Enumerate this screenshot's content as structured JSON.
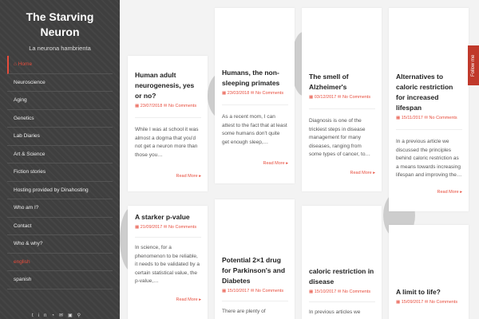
{
  "site": {
    "title_line1": "The Starving",
    "title_line2": "Neuron",
    "tagline": "La neurona hambrienta"
  },
  "nav": [
    {
      "label": "Home"
    },
    {
      "label": "Neuroscience"
    },
    {
      "label": "Aging"
    },
    {
      "label": "Genetics"
    },
    {
      "label": "Lab Diaries"
    },
    {
      "label": "Art & Science"
    },
    {
      "label": "Fiction stories"
    },
    {
      "label": "Hosting provided by Dinahosting"
    },
    {
      "label": "Who am I?"
    },
    {
      "label": "Contact"
    },
    {
      "label": "Who & why?"
    },
    {
      "label": "english"
    },
    {
      "label": "spanish"
    }
  ],
  "social_icons": [
    "twitter-icon",
    "linkedin-icon",
    "rss-icon",
    "email-icon",
    "instagram-icon",
    "search-icon"
  ],
  "follow_label": "Follow me",
  "posts": [
    {
      "title": "Human adult neurogenesis, yes or no?",
      "date": "23/07/2018",
      "comments": "No Comments",
      "excerpt": "While I was at school it was almost a dogma that you'd not get a neuron more than those you…",
      "more": "Read More"
    },
    {
      "title": "Humans, the non-sleeping primates",
      "date": "23/03/2018",
      "comments": "No Comments",
      "excerpt": "As a recent mom, I can attest to the fact that at least some humans don't quite get enough sleep,…",
      "more": "Read More"
    },
    {
      "title": "The smell of Alzheimer's",
      "date": "03/12/2017",
      "comments": "No Comments",
      "excerpt": "Diagnosis is one of the trickiest steps in disease management for many diseases, ranging from some types of cancer, to…",
      "more": "Read More"
    },
    {
      "title": "Alternatives to caloric restriction for increased lifespan",
      "date": "15/11/2017",
      "comments": "No Comments",
      "excerpt": "In a previous article we discussed the principles behind caloric restriction as a means towards increasing lifespan and improving the…",
      "more": "Read More"
    },
    {
      "title": "A starker p-value",
      "date": "21/09/2017",
      "comments": "No Comments",
      "excerpt": "In science, for a phenomenon to be reliable, it needs to be validated by a certain statistical value, the p-value,…",
      "more": "Read More"
    },
    {
      "title": "Potential 2×1 drug for Parkinson's and Diabetes",
      "date": "15/10/2017",
      "comments": "No Comments",
      "excerpt": "There are plenty of",
      "more": ""
    },
    {
      "title": "caloric restriction in disease",
      "date": "15/10/2017",
      "comments": "No Comments",
      "excerpt": "In previous articles we",
      "more": ""
    },
    {
      "title": "A limit to life?",
      "date": "15/09/2017",
      "comments": "No Comments",
      "excerpt": "",
      "more": ""
    }
  ]
}
